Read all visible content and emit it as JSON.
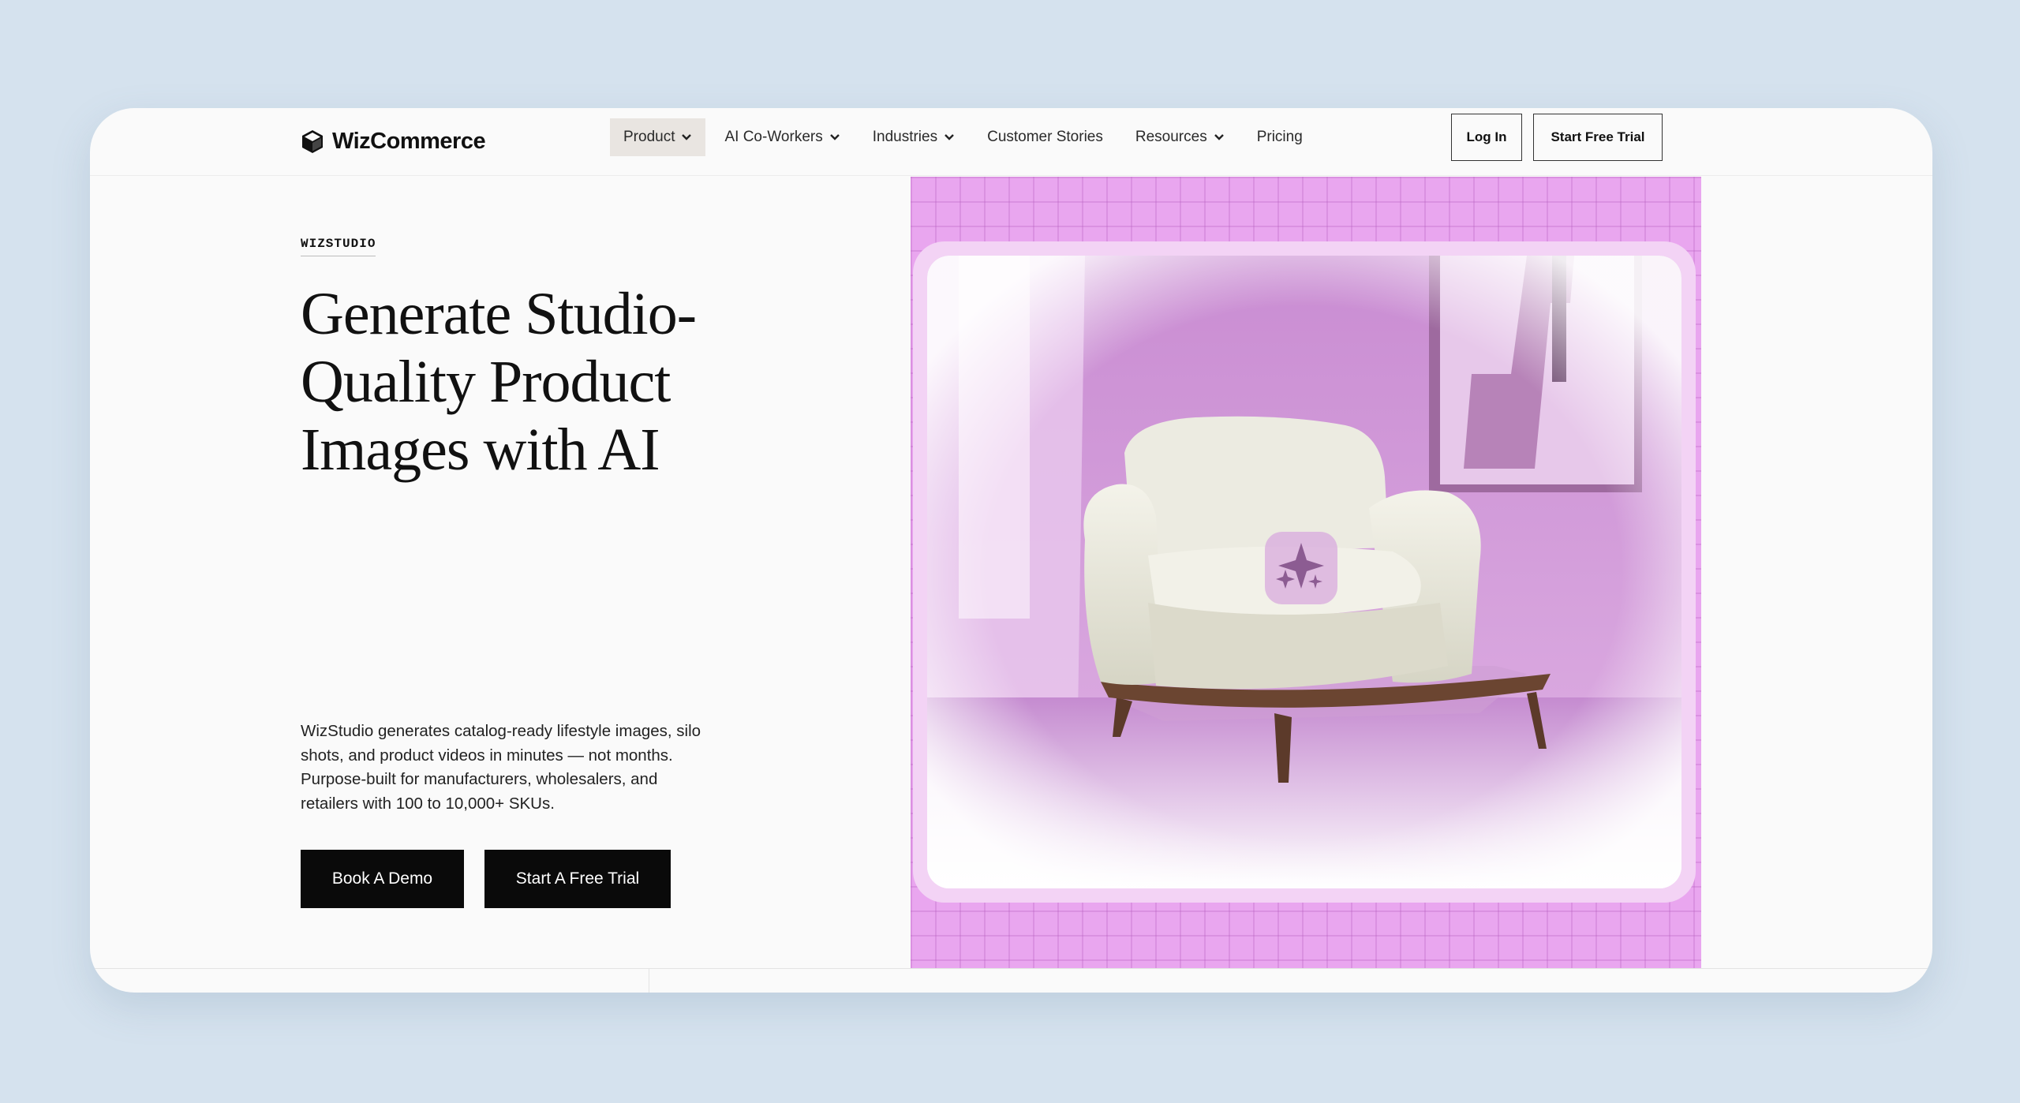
{
  "brand": {
    "name": "WizCommerce",
    "logo_icon": "cube-logo-icon"
  },
  "nav": {
    "items": [
      {
        "label": "Product",
        "dropdown": true,
        "active": true
      },
      {
        "label": "AI Co-Workers",
        "dropdown": true,
        "active": false
      },
      {
        "label": "Industries",
        "dropdown": true,
        "active": false
      },
      {
        "label": "Customer Stories",
        "dropdown": false,
        "active": false
      },
      {
        "label": "Resources",
        "dropdown": true,
        "active": false
      },
      {
        "label": "Pricing",
        "dropdown": false,
        "active": false
      }
    ],
    "login_label": "Log In",
    "trial_label": "Start Free Trial"
  },
  "hero": {
    "eyebrow": "WIZSTUDIO",
    "headline": "Generate Studio-Quality Product Images with AI",
    "description": "WizStudio generates catalog-ready lifestyle images, silo shots, and product videos in minutes — not months. Purpose-built for manufacturers, wholesalers, and retailers with 100 to 10,000+ SKUs.",
    "demo_label": "Book A Demo",
    "trial_label": "Start A Free Trial",
    "image_icon": "sparkle-icon"
  },
  "colors": {
    "page_bg": "#d5e2ee",
    "card_bg": "#fafafa",
    "accent_pink": "#e9a6ef",
    "button_dark": "#0a0a0a"
  }
}
